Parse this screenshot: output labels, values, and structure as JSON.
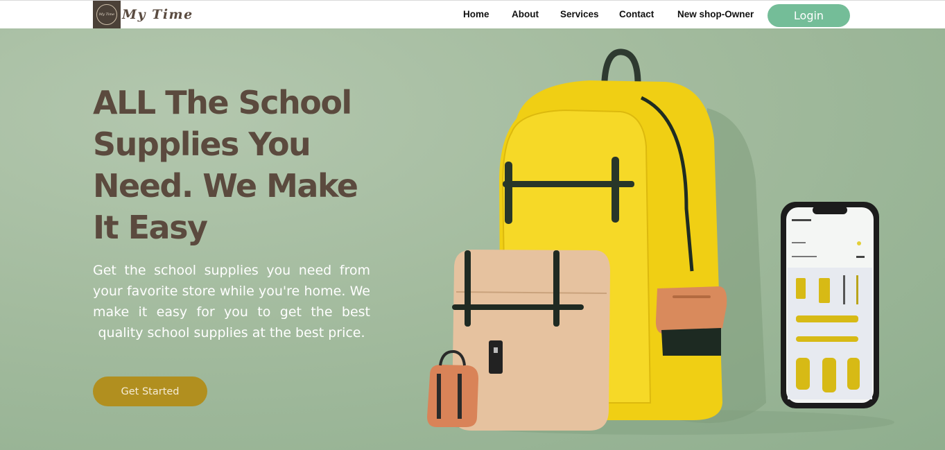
{
  "brand": {
    "name": "My Time",
    "logo_text": "My Time"
  },
  "nav": {
    "items": [
      {
        "label": "Home"
      },
      {
        "label": "About"
      },
      {
        "label": "Services"
      },
      {
        "label": "Contact"
      },
      {
        "label": "New shop-Owner"
      }
    ],
    "login_label": "Login"
  },
  "hero": {
    "headline": "ALL The School Supplies You Need. We Make It Easy",
    "description": "Get the school supplies you need from your favorite store while you're home. We make it easy for you to get the best quality school supplies at the best price.",
    "cta_label": "Get Started",
    "illustration_icon": "backpack-and-phone-illustration"
  },
  "colors": {
    "accent_green": "#74bd98",
    "cta_gold": "#b18f1f",
    "headline_brown": "#5b4a3e",
    "backpack_yellow": "#f2d21a"
  }
}
